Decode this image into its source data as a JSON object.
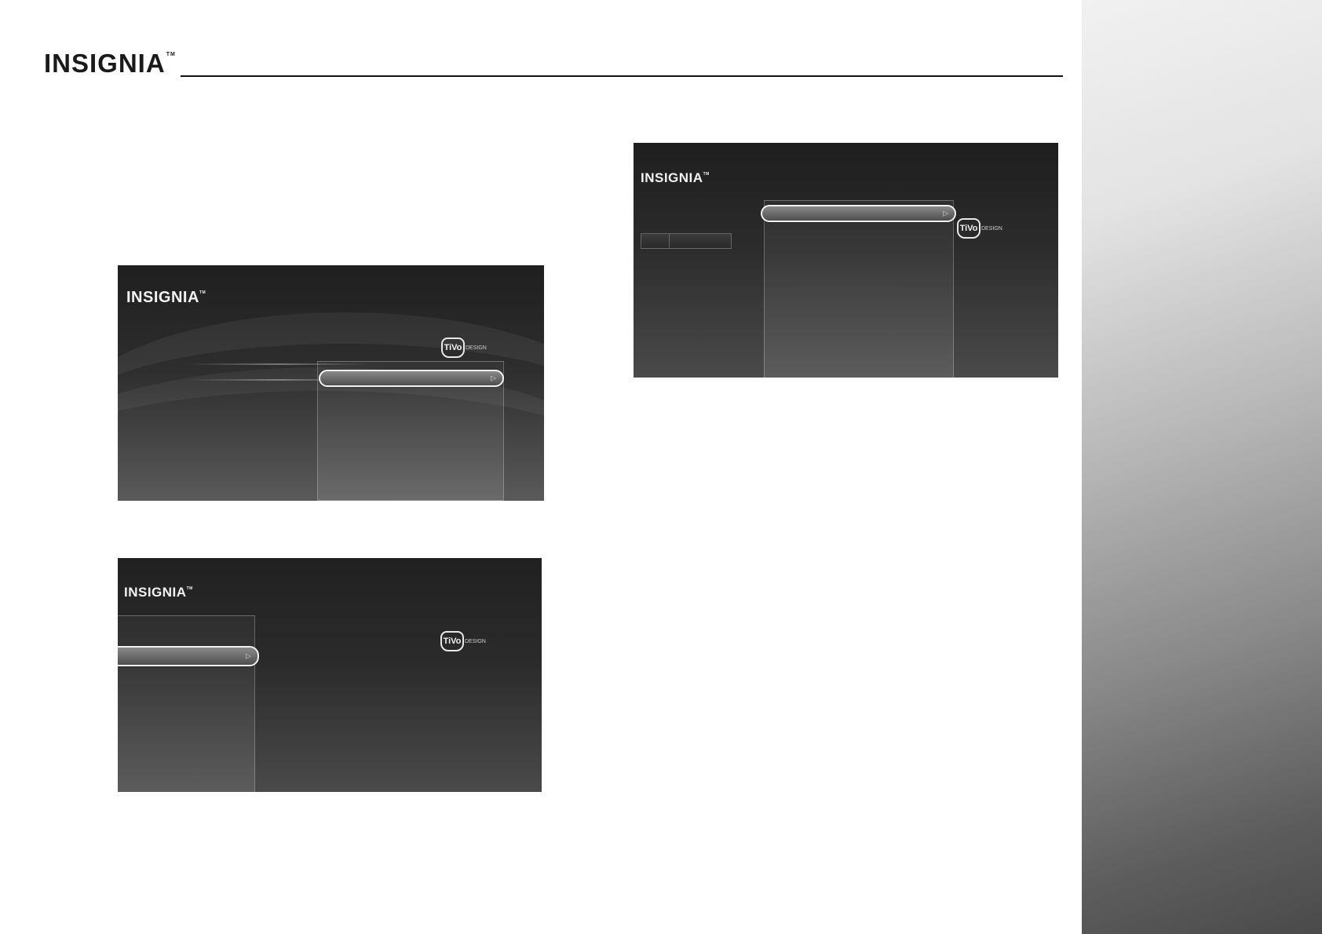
{
  "page": {
    "logo_text": "INSIGNIA",
    "logo_tm": "TM"
  },
  "screens": [
    {
      "logo_text": "INSIGNIA",
      "logo_tm": "TM",
      "tivo_badge": "TiVo",
      "tivo_text": "DESIGN"
    },
    {
      "logo_text": "INSIGNIA",
      "logo_tm": "TM",
      "tivo_badge": "TiVo",
      "tivo_text": "DESIGN"
    },
    {
      "logo_text": "INSIGNIA",
      "logo_tm": "TM",
      "tivo_badge": "TiVo",
      "tivo_text": "DESIGN"
    }
  ],
  "icons": {
    "highlight_arrow": "play-arrow-icon",
    "tivo": "tivo-logo-icon"
  },
  "colors": {
    "screen_dark": "#242424",
    "highlight_border": "#f2f2f2",
    "side_gradient_light": "#f1f1f1",
    "side_gradient_dark": "#4a4a4a"
  }
}
